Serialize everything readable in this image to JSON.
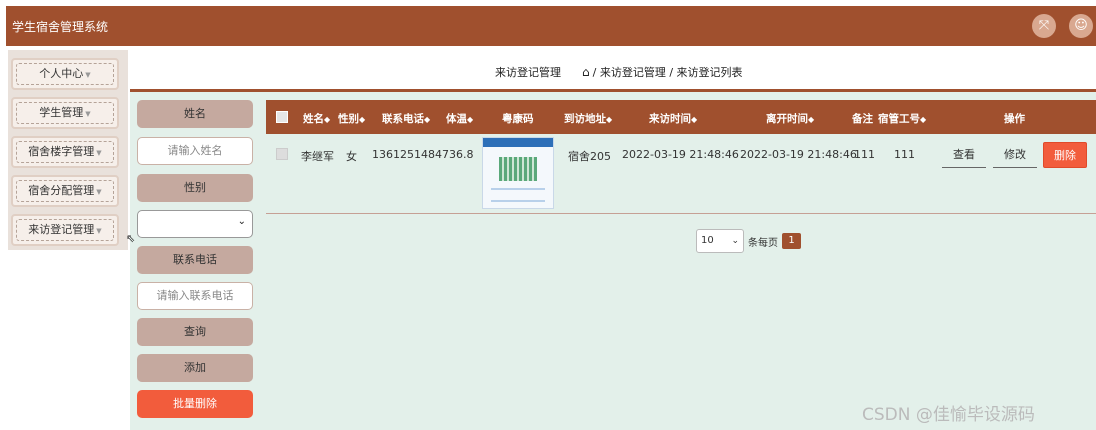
{
  "app": {
    "title": "学生宿舍管理系统",
    "fullscreen_icon": "fullscreen-icon",
    "user_icon": "user-icon"
  },
  "colors": {
    "primary": "#a0502e",
    "danger": "#f25c3c",
    "main_bg": "#e3f0ea",
    "label_bg": "#c5a99f"
  },
  "sidebar": {
    "items": [
      {
        "label": "个人中心"
      },
      {
        "label": "学生管理"
      },
      {
        "label": "宿舍楼字管理"
      },
      {
        "label": "宿舍分配管理"
      },
      {
        "label": "来访登记管理"
      }
    ]
  },
  "breadcrumb": {
    "title": "来访登记管理",
    "home_icon": "home-icon",
    "path": "/ 来访登记管理 / 来访登记列表"
  },
  "search": {
    "name_label": "姓名",
    "name_placeholder": "请输入姓名",
    "gender_label": "性别",
    "gender_value": "",
    "phone_label": "联系电话",
    "phone_placeholder": "请输入联系电话",
    "query_label": "查询",
    "add_label": "添加",
    "batch_delete_label": "批量删除"
  },
  "table": {
    "headers": {
      "name": "姓名",
      "gender": "性别",
      "phone": "联系电话",
      "temperature": "体温",
      "health_code": "粤康码",
      "address": "到访地址",
      "visit_time": "来访时间",
      "leave_time": "离开时间",
      "remark": "备注",
      "manager_id": "宿管工号",
      "actions": "操作"
    },
    "rows": [
      {
        "name": "李继军",
        "gender": "女",
        "phone": "13612514847",
        "temperature": "36.8",
        "address": "宿舍205",
        "visit_time": "2022-03-19 21:48:46",
        "leave_time": "2022-03-19 21:48:46",
        "remark": "111",
        "manager_id": "111",
        "view_label": "查看",
        "edit_label": "修改",
        "delete_label": "删除"
      }
    ]
  },
  "pagination": {
    "page_size": "10",
    "per_page_text": "条每页",
    "current_page": "1"
  },
  "watermark": "CSDN @佳愉毕设源码"
}
